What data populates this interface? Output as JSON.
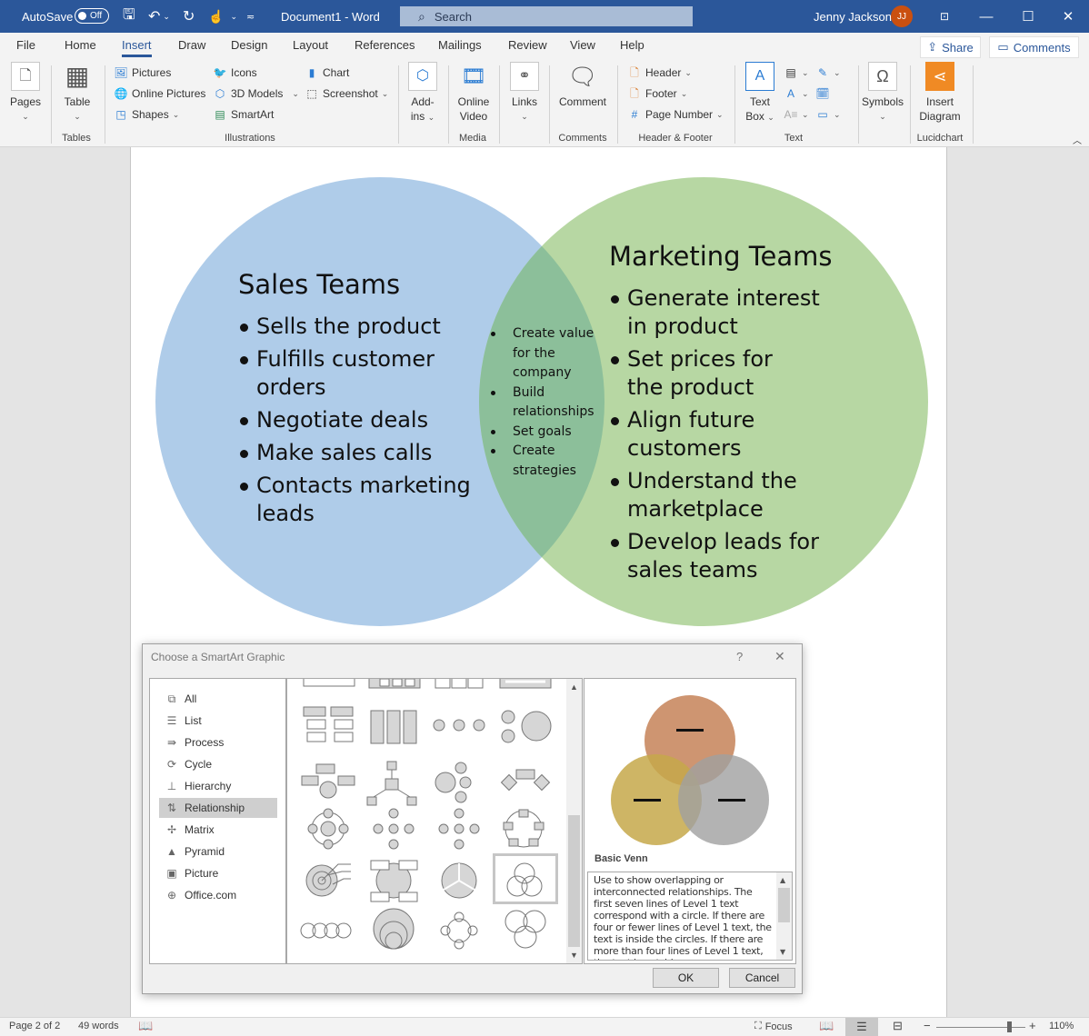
{
  "titlebar": {
    "autosave_label": "AutoSave",
    "autosave_state": "Off",
    "document_title": "Document1  -  Word",
    "search_placeholder": "Search",
    "user_name": "Jenny Jackson",
    "user_initials": "JJ"
  },
  "menu": {
    "tabs": [
      "File",
      "Home",
      "Insert",
      "Draw",
      "Design",
      "Layout",
      "References",
      "Mailings",
      "Review",
      "View",
      "Help"
    ],
    "active_tab": "Insert",
    "share_label": "Share",
    "comments_label": "Comments"
  },
  "ribbon": {
    "pages": "Pages",
    "table": "Table",
    "tables_group": "Tables",
    "pictures": "Pictures",
    "online_pictures": "Online Pictures",
    "shapes": "Shapes",
    "icons": "Icons",
    "models_3d": "3D Models",
    "smartart": "SmartArt",
    "chart": "Chart",
    "screenshot": "Screenshot",
    "illustrations_group": "Illustrations",
    "addins_1": "Add-",
    "addins_2": "ins",
    "online_video_1": "Online",
    "online_video_2": "Video",
    "media_group": "Media",
    "links": "Links",
    "comment": "Comment",
    "comments_group": "Comments",
    "header": "Header",
    "footer": "Footer",
    "page_number": "Page Number",
    "header_footer_group": "Header & Footer",
    "text_box_1": "Text",
    "text_box_2": "Box",
    "text_group": "Text",
    "symbols": "Symbols",
    "insert_diagram_1": "Insert",
    "insert_diagram_2": "Diagram",
    "lucidchart_group": "Lucidchart"
  },
  "venn": {
    "colors": {
      "left": "#afcce9",
      "right": "#b7d7a3",
      "overlap": "#8cbf9a"
    },
    "left": {
      "title": "Sales Teams",
      "items": [
        "Sells the product",
        "Fulfills customer orders",
        "Negotiate deals",
        "Make sales calls",
        "Contacts marketing leads"
      ]
    },
    "right": {
      "title": "Marketing Teams",
      "items": [
        "Generate interest in product",
        "Set prices for the product",
        "Align future customers",
        "Understand the marketplace",
        "Develop leads for sales teams"
      ]
    },
    "overlap": {
      "items": [
        "Create value for the company",
        "Build relationships",
        "Set goals",
        "Create strategies"
      ]
    }
  },
  "dialog": {
    "title": "Choose a SmartArt Graphic",
    "help": "?",
    "close": "✕",
    "categories": [
      "All",
      "List",
      "Process",
      "Cycle",
      "Hierarchy",
      "Relationship",
      "Matrix",
      "Pyramid",
      "Picture",
      "Office.com"
    ],
    "category_icons": [
      "all-icon",
      "list-icon",
      "process-icon",
      "cycle-icon",
      "hierarchy-icon",
      "relationship-icon",
      "matrix-icon",
      "pyramid-icon",
      "picture-icon",
      "globe-icon"
    ],
    "selected_category": "Relationship",
    "selected_layout": "Basic Venn",
    "description": "Use to show overlapping or interconnected relationships. The first seven lines of Level 1 text correspond with a circle. If there are four or fewer lines of Level 1 text, the text is inside the circles. If there are more than four lines of Level 1 text, the text is outside",
    "ok_label": "OK",
    "cancel_label": "Cancel",
    "preview_colors": [
      "#c98a62",
      "#c6a84a",
      "#a0a0a0"
    ]
  },
  "status": {
    "page": "Page 2 of 2",
    "words": "49 words",
    "focus": "Focus",
    "zoom": "110%",
    "zoom_level_percent": 110
  }
}
